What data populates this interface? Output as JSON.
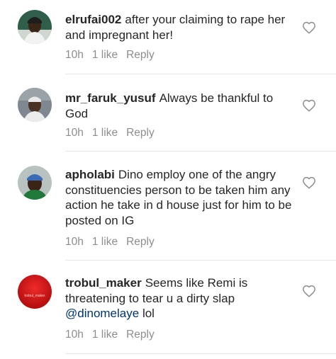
{
  "comments": [
    {
      "username": "elrufai002",
      "text": "after your claiming to rape her and impregnant her!",
      "mention": "",
      "suffix": "",
      "time": "10h",
      "likes": "1 like",
      "reply": "Reply"
    },
    {
      "username": "mr_faruk_yusuf",
      "text": "Always be thankful to God",
      "mention": "",
      "suffix": "",
      "time": "10h",
      "likes": "1 like",
      "reply": "Reply"
    },
    {
      "username": "apholabi",
      "text": "Dino employ one of the angry constituencies person to be taken him any action he take in d house just for him to be posted on IG",
      "mention": "",
      "suffix": "",
      "time": "10h",
      "likes": "1 like",
      "reply": "Reply"
    },
    {
      "username": "trobul_maker",
      "text": "Seems like Remi is threatening to tear u a dirty slap",
      "mention": "@dinomelaye",
      "suffix": "lol",
      "time": "10h",
      "likes": "1 like",
      "reply": "Reply",
      "avatar_text": "trobul_maker"
    }
  ],
  "icons": {
    "like": "heart-outline-icon"
  },
  "colors": {
    "text": "#262626",
    "meta": "#8e8e8e",
    "mention": "#003569"
  }
}
